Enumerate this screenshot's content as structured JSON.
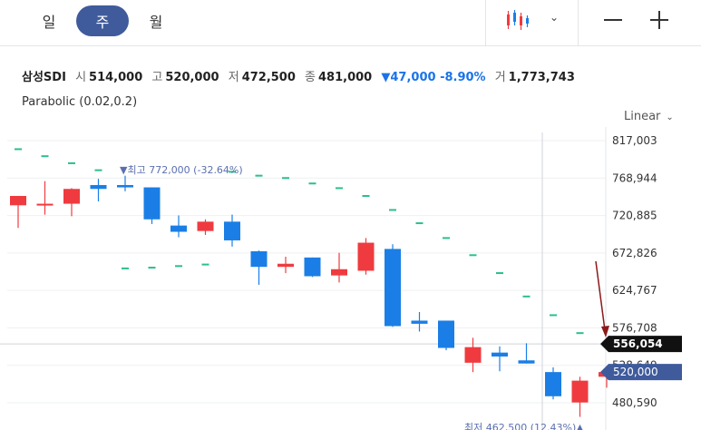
{
  "tabs": [
    {
      "label": "일",
      "active": false
    },
    {
      "label": "주",
      "active": true
    },
    {
      "label": "월",
      "active": false
    }
  ],
  "toolbar": {
    "chart_type_icon": "candlestick-icon",
    "dropdown_icon": "chevron-down-icon",
    "zoom_out_icon": "minus-icon",
    "zoom_in_icon": "plus-icon"
  },
  "quote": {
    "name": "삼성SDI",
    "open_label": "시",
    "open": "514,000",
    "high_label": "고",
    "high": "520,000",
    "low_label": "저",
    "low": "472,500",
    "close_label": "종",
    "close": "481,000",
    "change": "▼47,000 -8.90%",
    "volume_label": "거",
    "volume": "1,773,743"
  },
  "indicator": "Parabolic (0.02,0.2)",
  "scale": "Linear",
  "colors": {
    "up": "#ef3b3f",
    "down": "#1a7ee6",
    "sar": "#2bbf8a",
    "accent": "#3f5b9c",
    "last_price_tag": "#111111",
    "arrow": "#8b1a1a"
  },
  "chart_data": {
    "type": "candlestick",
    "ylim": [
      455000,
      830000
    ],
    "y_ticks": [
      "817,003",
      "768,944",
      "720,885",
      "672,826",
      "624,767",
      "576,708",
      "528,649",
      "480,590"
    ],
    "candles": [
      {
        "o": 734000,
        "h": 745000,
        "l": 705000,
        "c": 746000
      },
      {
        "o": 734000,
        "h": 765000,
        "l": 722000,
        "c": 736000
      },
      {
        "o": 736000,
        "h": 756000,
        "l": 720000,
        "c": 755000
      },
      {
        "o": 760000,
        "h": 768000,
        "l": 739000,
        "c": 755000
      },
      {
        "o": 760000,
        "h": 772000,
        "l": 752000,
        "c": 757000
      },
      {
        "o": 757000,
        "h": 757000,
        "l": 710000,
        "c": 716000
      },
      {
        "o": 708000,
        "h": 721000,
        "l": 693000,
        "c": 700000
      },
      {
        "o": 701000,
        "h": 716000,
        "l": 696000,
        "c": 713000
      },
      {
        "o": 713000,
        "h": 722000,
        "l": 681000,
        "c": 689000
      },
      {
        "o": 675000,
        "h": 676000,
        "l": 632000,
        "c": 655000
      },
      {
        "o": 655000,
        "h": 668000,
        "l": 647000,
        "c": 659000
      },
      {
        "o": 667000,
        "h": 667000,
        "l": 642000,
        "c": 643000
      },
      {
        "o": 644000,
        "h": 673000,
        "l": 635000,
        "c": 652000
      },
      {
        "o": 650000,
        "h": 692000,
        "l": 645000,
        "c": 686000
      },
      {
        "o": 678000,
        "h": 684000,
        "l": 578000,
        "c": 579000
      },
      {
        "o": 586000,
        "h": 597000,
        "l": 572000,
        "c": 582000
      },
      {
        "o": 586000,
        "h": 586000,
        "l": 548000,
        "c": 551000
      },
      {
        "o": 532000,
        "h": 564000,
        "l": 520000,
        "c": 552000
      },
      {
        "o": 545000,
        "h": 553000,
        "l": 521000,
        "c": 540000
      },
      {
        "o": 535000,
        "h": 557000,
        "l": 533000,
        "c": 531000
      },
      {
        "o": 520000,
        "h": 526000,
        "l": 485000,
        "c": 489000
      },
      {
        "o": 481000,
        "h": 514000,
        "l": 462500,
        "c": 509000
      },
      {
        "o": 514000,
        "h": 520000,
        "l": 500000,
        "c": 520000
      }
    ],
    "sar": [
      806000,
      797000,
      788000,
      779000,
      null,
      null,
      null,
      null,
      777000,
      772000,
      769000,
      762000,
      756000,
      746000,
      728000,
      711000,
      692000,
      670000,
      647000,
      617000,
      593000,
      570000,
      null
    ],
    "sar_lower": [
      null,
      null,
      null,
      null,
      653000,
      654000,
      656000,
      658000,
      null,
      null,
      null,
      null,
      null,
      null,
      null,
      null,
      null,
      null,
      null,
      null,
      null,
      null,
      null
    ],
    "high_annotation": "▼최고 772,000 (-32.64%)",
    "low_annotation": "최저 462,500 (12.43%)▲",
    "last_price": "556,054",
    "current_price": "520,000"
  }
}
